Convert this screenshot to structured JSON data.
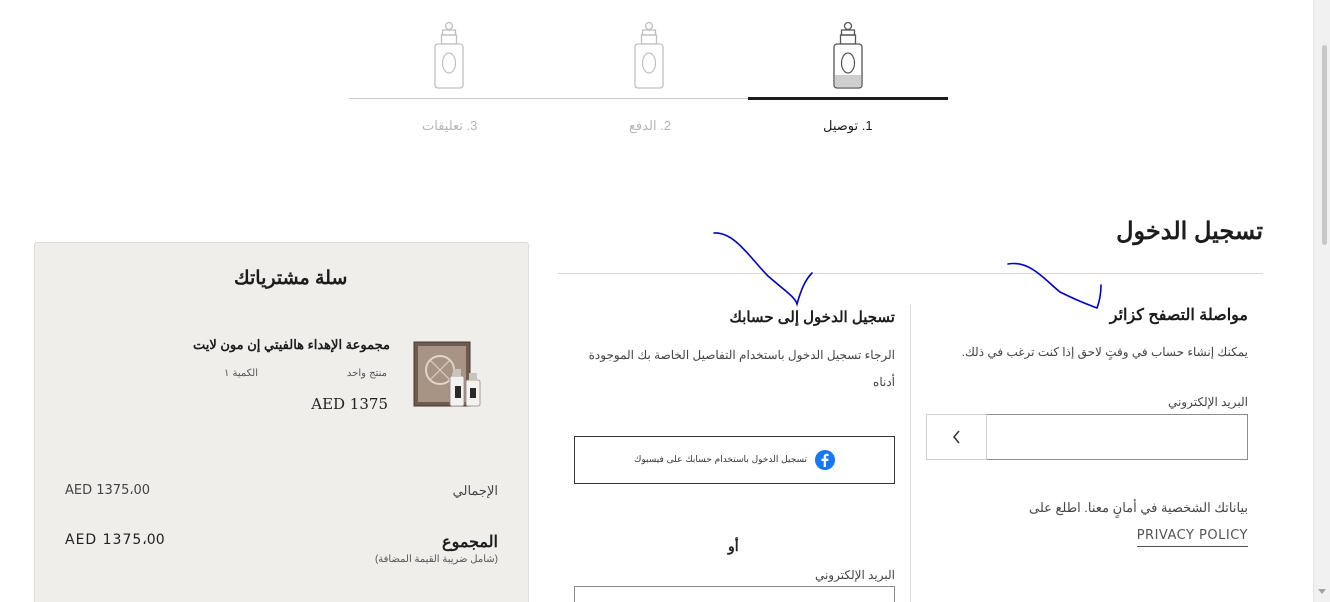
{
  "checkout_steps": [
    {
      "label": "1. توصيل",
      "active": true
    },
    {
      "label": "2. الدفع",
      "active": false
    },
    {
      "label": "3. تعليقات",
      "active": false
    }
  ],
  "login": {
    "title": "تسجيل الدخول",
    "guest": {
      "heading": "مواصلة التصفح كزائر",
      "description": "يمكنك إنشاء حساب في وقتٍ لاحق إذا كنت ترغب في ذلك.",
      "email_label": "البريد الإلكتروني",
      "email_value": "",
      "submit_icon": "chevron-left-icon",
      "privacy_text": "بياناتك الشخصية في أمانٍ معنا. اطلع على",
      "privacy_link": "PRIVACY POLICY"
    },
    "account": {
      "heading": "تسجيل الدخول إلى حسابك",
      "description": "الرجاء تسجيل الدخول باستخدام التفاصيل الخاصة بك الموجودة أدناه",
      "facebook_button": "تسجيل الدخول باستخدام حسابك على فيسبوك",
      "facebook_icon": "facebook-icon",
      "or": "أو",
      "email_label": "البريد الإلكتروني",
      "email_value": ""
    }
  },
  "cart": {
    "title": "سلة مشترياتك",
    "item": {
      "name": "مجموعة الإهداء هالفيتي إن مون لايت",
      "count": "منتج واحد",
      "qty": "الكمية ١",
      "price": "AED 1375"
    },
    "subtotal_label": "الإجمالي",
    "subtotal_value": "AED 1375،00",
    "total_label": "المجموع",
    "total_note": "(شامل ضريبة القيمة المضافة)",
    "total_value": "AED 1375،00"
  },
  "colors": {
    "cart_background": "#efeeeb",
    "text_primary": "#1c1c1c",
    "inactive_step": "#b5b5b5",
    "facebook_blue": "#1877f2",
    "annotation_ink": "#0000cc"
  }
}
